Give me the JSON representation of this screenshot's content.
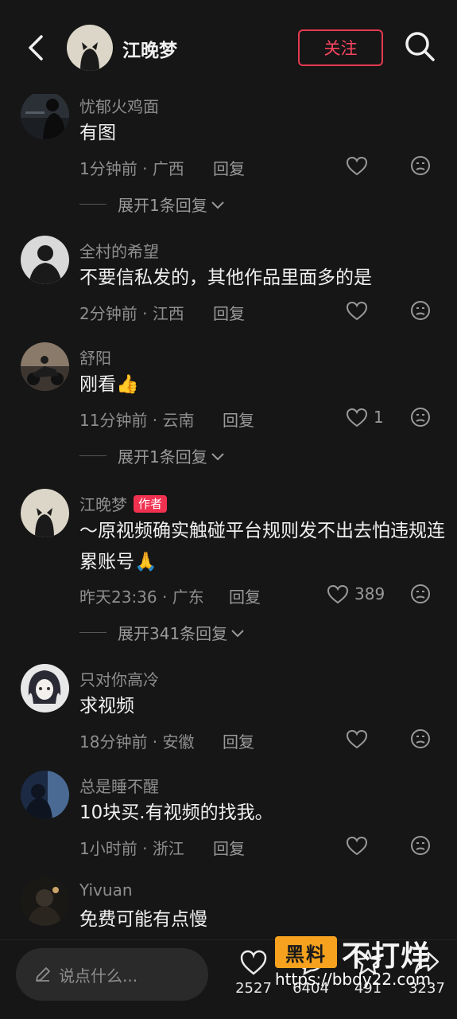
{
  "header": {
    "name": "江晚梦",
    "follow_label": "关注"
  },
  "comments": [
    {
      "username": "忧郁火鸡面",
      "text": "有图",
      "time": "1分钟前",
      "location": "广西",
      "reply_label": "回复",
      "likes": "",
      "expand_label": "展开1条回复"
    },
    {
      "username": "全村的希望",
      "text": "不要信私发的，其他作品里面多的是",
      "time": "2分钟前",
      "location": "江西",
      "reply_label": "回复",
      "likes": ""
    },
    {
      "username": "舒阳",
      "text": "刚看👍",
      "time": "11分钟前",
      "location": "云南",
      "reply_label": "回复",
      "likes": "1",
      "expand_label": "展开1条回复"
    },
    {
      "username": "江晚梦",
      "badge": "作者",
      "text": "～原视频确实触碰平台规则发不出去怕违规连累账号🙏",
      "time": "昨天23:36",
      "location": "广东",
      "reply_label": "回复",
      "likes": "389",
      "expand_label": "展开341条回复"
    },
    {
      "username": "只对你高冷",
      "text": "求视频",
      "time": "18分钟前",
      "location": "安徽",
      "reply_label": "回复",
      "likes": ""
    },
    {
      "username": "总是睡不醒",
      "text": "10块买.有视频的找我。",
      "time": "1小时前",
      "location": "浙江",
      "reply_label": "回复",
      "likes": ""
    },
    {
      "username": "Yivuan",
      "text": "免费可能有点慢"
    }
  ],
  "bottom_bar": {
    "input_placeholder": "说点什么...",
    "likes_count": "2527",
    "comments_count": "6404",
    "favorites_count": "491",
    "shares_count": "3237"
  },
  "watermark": {
    "box_text": "黑料",
    "big_text": "不打烊",
    "url": "https://bbdy22.com"
  },
  "colors": {
    "background": "#161616",
    "accent": "#e33a50",
    "muted_text": "#8e8e8e"
  }
}
